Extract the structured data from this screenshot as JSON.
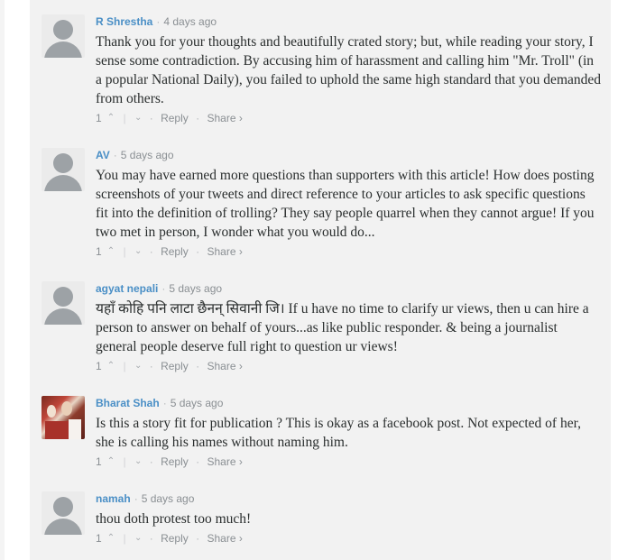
{
  "comments": [
    {
      "author": "R Shrestha",
      "time": "4 days ago",
      "text": "Thank you for your thoughts and beautifully crated story; but, while reading your story, I sense some contradiction. By accusing him of harassment and calling him \"Mr. Troll\" (in a popular National Daily), you failed to uphold the same high standard that you demanded from others.",
      "votes": "1",
      "avatar": "default"
    },
    {
      "author": "AV",
      "time": "5 days ago",
      "text": "You may have earned more questions than supporters with this article! How does posting screenshots of your tweets and direct reference to your articles to ask specific questions fit into the definition of trolling? They say people quarrel when they cannot argue! If you two met in person, I wonder what you would do...",
      "votes": "1",
      "avatar": "default"
    },
    {
      "author": "agyat nepali",
      "time": "5 days ago",
      "text": "यहाँ कोहि पनि लाटा छैनन् सिवानी जि। If u have no time to clarify ur views, then u can hire a person to answer on behalf of yours...as like public responder. & being a journalist general people deserve full right to question ur views!",
      "votes": "1",
      "avatar": "default"
    },
    {
      "author": "Bharat Shah",
      "time": "5 days ago",
      "text": "Is this a story fit for publication ? This is okay as a facebook post. Not expected of her, she is calling his names without naming him.",
      "votes": "1",
      "avatar": "photo"
    },
    {
      "author": "namah",
      "time": "5 days ago",
      "text": "thou doth protest too much!",
      "votes": "1",
      "avatar": "default"
    }
  ],
  "labels": {
    "reply": "Reply",
    "share": "Share ›",
    "separator": "·",
    "upvote_icon": "chevron-up-icon",
    "downvote_icon": "chevron-down-icon"
  },
  "colors": {
    "author": "#4a8fc6",
    "panel_bg": "#f2f2f2",
    "text": "#2a2e2e",
    "muted": "#8a8f93"
  }
}
